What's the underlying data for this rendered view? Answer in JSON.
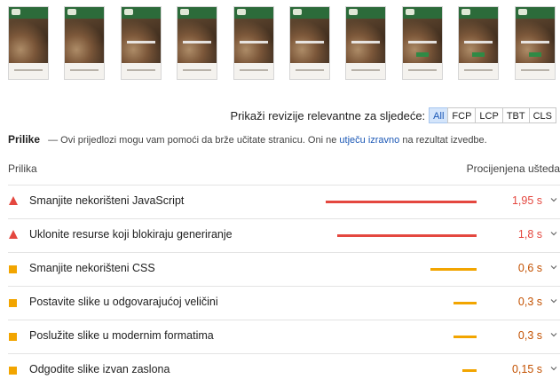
{
  "filmstrip": {
    "frames": [
      {
        "title_visible": false,
        "cta_visible": false
      },
      {
        "title_visible": false,
        "cta_visible": false
      },
      {
        "title_visible": true,
        "cta_visible": false
      },
      {
        "title_visible": true,
        "cta_visible": false
      },
      {
        "title_visible": true,
        "cta_visible": false
      },
      {
        "title_visible": true,
        "cta_visible": false
      },
      {
        "title_visible": true,
        "cta_visible": false
      },
      {
        "title_visible": true,
        "cta_visible": true
      },
      {
        "title_visible": true,
        "cta_visible": true
      },
      {
        "title_visible": true,
        "cta_visible": true
      }
    ]
  },
  "filter": {
    "label": "Prikaži revizije relevantne za sljedeće:",
    "chips": [
      {
        "label": "All",
        "active": true
      },
      {
        "label": "FCP",
        "active": false
      },
      {
        "label": "LCP",
        "active": false
      },
      {
        "label": "TBT",
        "active": false
      },
      {
        "label": "CLS",
        "active": false
      }
    ]
  },
  "section": {
    "title": "Prilike",
    "description_prefix": "— Ovi prijedlozi mogu vam pomoći da brže učitate stranicu. Oni ne ",
    "link_text": "utječu izravno",
    "description_suffix": " na rezultat izvedbe."
  },
  "table": {
    "col_opportunity": "Prilika",
    "col_savings": "Procijenjena ušteda"
  },
  "colors": {
    "fail": "#e4473f",
    "average": "#f2a500"
  },
  "opportunities": [
    {
      "title": "Smanjite nekorišteni JavaScript",
      "savings": "1,95 s",
      "savings_seconds": 1.95,
      "rating": "fail"
    },
    {
      "title": "Uklonite resurse koji blokiraju generiranje",
      "savings": "1,8 s",
      "savings_seconds": 1.8,
      "rating": "fail"
    },
    {
      "title": "Smanjite nekorišteni CSS",
      "savings": "0,6 s",
      "savings_seconds": 0.6,
      "rating": "average"
    },
    {
      "title": "Postavite slike u odgovarajućoj veličini",
      "savings": "0,3 s",
      "savings_seconds": 0.3,
      "rating": "average"
    },
    {
      "title": "Poslužite slike u modernim formatima",
      "savings": "0,3 s",
      "savings_seconds": 0.3,
      "rating": "average"
    },
    {
      "title": "Odgodite slike izvan zaslona",
      "savings": "0,15 s",
      "savings_seconds": 0.15,
      "rating": "average"
    }
  ]
}
